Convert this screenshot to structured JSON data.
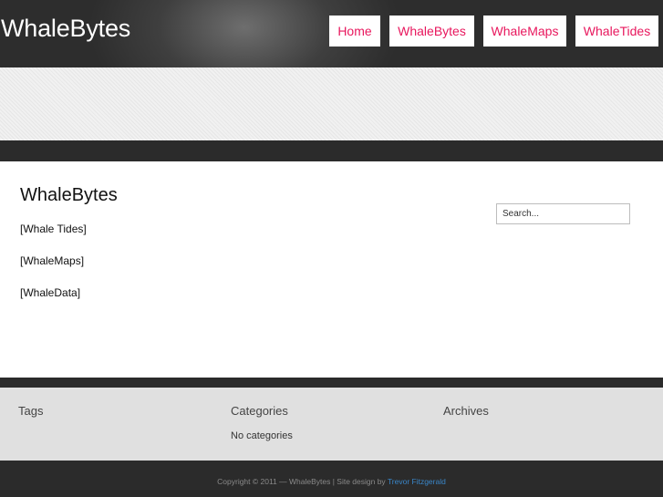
{
  "site": {
    "title": "WhaleBytes"
  },
  "nav": {
    "items": [
      {
        "label": "Home"
      },
      {
        "label": "WhaleBytes"
      },
      {
        "label": "WhaleMaps"
      },
      {
        "label": "WhaleTides"
      }
    ]
  },
  "main": {
    "title": "WhaleBytes",
    "links": [
      {
        "label": "[Whale Tides]"
      },
      {
        "label": "[WhaleMaps]"
      },
      {
        "label": "[WhaleData]"
      }
    ]
  },
  "search": {
    "placeholder": "Search..."
  },
  "footer": {
    "tags_title": "Tags",
    "categories_title": "Categories",
    "categories_text": "No categories",
    "archives_title": "Archives",
    "copyright": "Copyright © 2011 — WhaleBytes | Site design by ",
    "credit": "Trevor Fitzgerald"
  },
  "colors": {
    "accent": "#e8175d",
    "header_dark": "#2b2b2b",
    "footer_light": "#e0e0e0",
    "link_blue": "#3a86c8"
  }
}
